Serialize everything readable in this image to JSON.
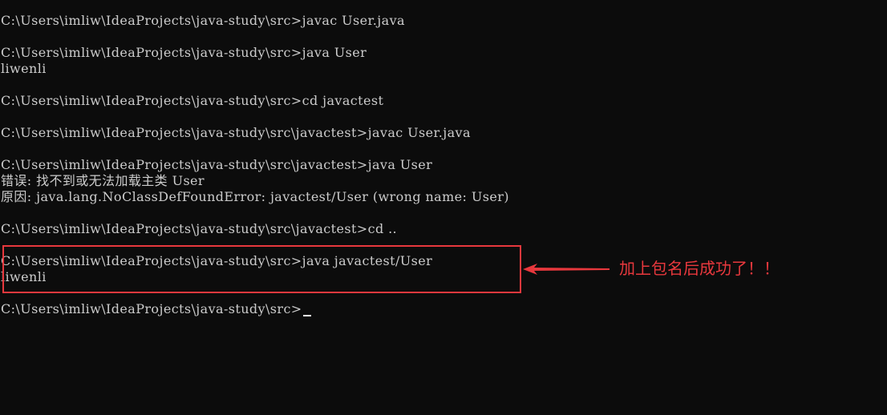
{
  "terminal": {
    "lines": {
      "l1": "C:\\Users\\imliw\\IdeaProjects\\java-study\\src>javac User.java",
      "l2": "C:\\Users\\imliw\\IdeaProjects\\java-study\\src>java User",
      "l3": "liwenli",
      "l4": "C:\\Users\\imliw\\IdeaProjects\\java-study\\src>cd javactest",
      "l5": "C:\\Users\\imliw\\IdeaProjects\\java-study\\src\\javactest>javac User.java",
      "l6": "C:\\Users\\imliw\\IdeaProjects\\java-study\\src\\javactest>java User",
      "l7": "错误: 找不到或无法加载主类 User",
      "l8": "原因: java.lang.NoClassDefFoundError: javactest/User (wrong name: User)",
      "l9": "C:\\Users\\imliw\\IdeaProjects\\java-study\\src\\javactest>cd ..",
      "l10": "C:\\Users\\imliw\\IdeaProjects\\java-study\\src>java javactest/User",
      "l11": "liwenli",
      "l12": "C:\\Users\\imliw\\IdeaProjects\\java-study\\src>"
    }
  },
  "annotation": {
    "text": "加上包名后成功了！！"
  },
  "colors": {
    "background": "#0c0c0c",
    "text": "#cccccc",
    "annotation": "#e8383d"
  }
}
